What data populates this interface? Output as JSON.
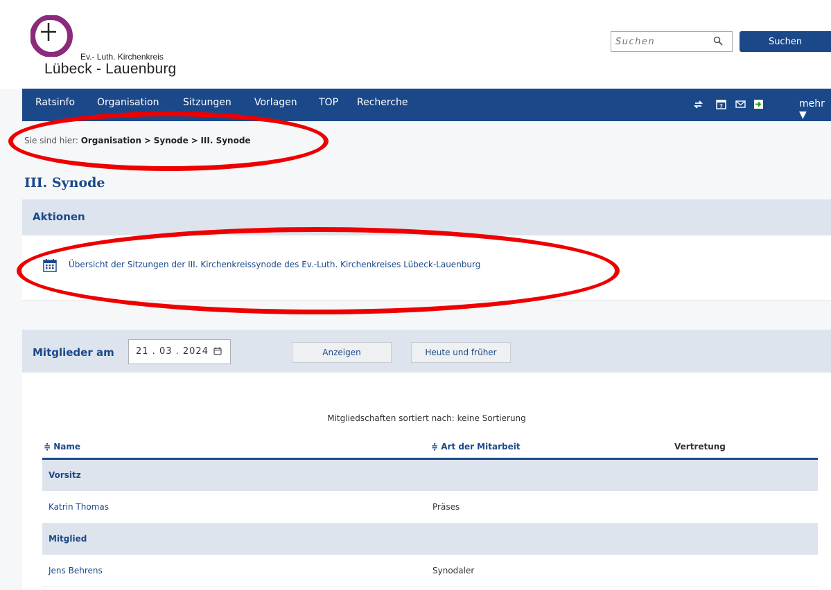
{
  "brand": {
    "subtitle": "Ev.- Luth. Kirchenkreis",
    "name": "Lübeck - Lauenburg"
  },
  "search": {
    "placeholder": "Suchen",
    "button": "Suchen"
  },
  "nav": {
    "items": [
      "Ratsinfo",
      "Organisation",
      "Sitzungen",
      "Vorlagen",
      "TOP",
      "Recherche"
    ],
    "more": "mehr ▼",
    "icons": [
      "sync-icon",
      "calendar-icon",
      "mail-icon",
      "logout-icon"
    ]
  },
  "breadcrumb": {
    "prefix": "Sie sind hier:",
    "trail": [
      "Organisation",
      "Synode",
      "III. Synode"
    ],
    "separator": ">"
  },
  "page_title": "III. Synode",
  "actions": {
    "title": "Aktionen",
    "link": "Übersicht der Sitzungen der III. Kirchenkreissynode des Ev.-Luth. Kirchenkreises Lübeck-Lauenburg"
  },
  "members": {
    "label": "Mitglieder am",
    "date": "21 . 03 . 2024",
    "show_button": "Anzeigen",
    "today_button": "Heute und früher",
    "sort_note": "Mitgliedschaften sortiert nach: keine Sortierung",
    "columns": [
      "≑ Name",
      "≑ Art der Mitarbeit",
      "Vertretung"
    ],
    "rows": [
      {
        "type": "group",
        "name": "Vorsitz"
      },
      {
        "type": "data",
        "name": "Katrin Thomas",
        "role": "Präses"
      },
      {
        "type": "group",
        "name": "Mitglied"
      },
      {
        "type": "data",
        "name": "Jens Behrens",
        "role": "Synodaler"
      }
    ]
  },
  "colors": {
    "primary": "#1b4889",
    "panel": "#dde4ed",
    "annotation": "#ee0000",
    "logo": "#8b2a7a"
  }
}
